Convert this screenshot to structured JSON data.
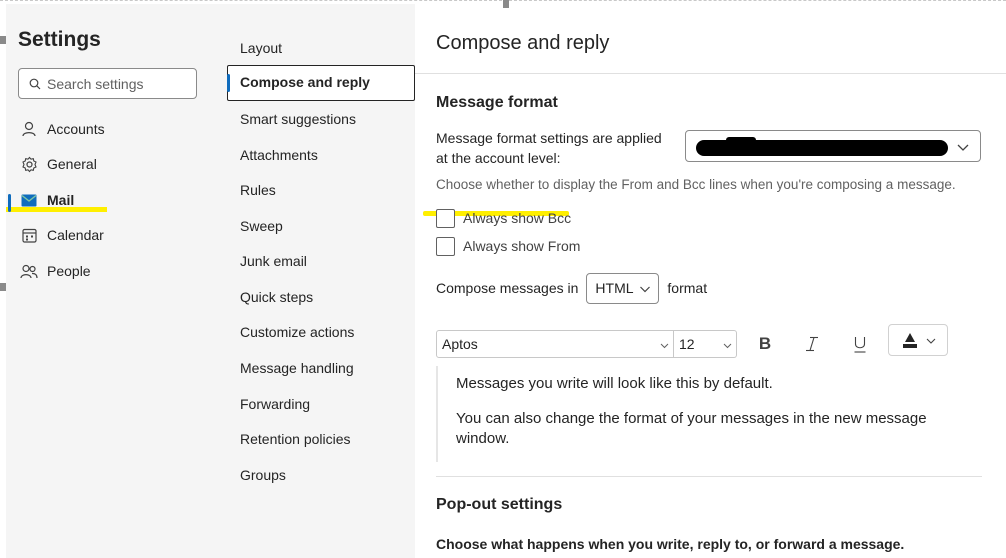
{
  "left_nav": {
    "title": "Settings",
    "search_placeholder": "Search settings",
    "items": [
      {
        "label": "Accounts",
        "icon": "person-icon"
      },
      {
        "label": "General",
        "icon": "gear-icon"
      },
      {
        "label": "Mail",
        "icon": "mail-icon",
        "active": true
      },
      {
        "label": "Calendar",
        "icon": "calendar-icon"
      },
      {
        "label": "People",
        "icon": "people-icon"
      }
    ]
  },
  "mail_nav": {
    "items": [
      "Layout",
      "Compose and reply",
      "Smart suggestions",
      "Attachments",
      "Rules",
      "Sweep",
      "Junk email",
      "Quick steps",
      "Customize actions",
      "Message handling",
      "Forwarding",
      "Retention policies",
      "Groups"
    ],
    "selected": "Compose and reply"
  },
  "main": {
    "title": "Compose and reply",
    "message_format": {
      "heading": "Message format",
      "account_label": "Message format settings are applied at the account level:",
      "account_value": "",
      "hint": "Choose whether to display the From and Bcc lines when you're composing a message.",
      "checkbox_bcc": "Always show Bcc",
      "checkbox_from": "Always show From",
      "compose_prefix": "Compose messages in",
      "compose_format": "HTML",
      "compose_suffix": "format",
      "font_name": "Aptos",
      "font_size": "12",
      "preview_line1": "Messages you write will look like this by default.",
      "preview_line2a": "You can also change the format of your messages in the new message",
      "preview_line2b": "window."
    },
    "popout": {
      "heading": "Pop-out settings",
      "description": "Choose what happens when you write, reply to, or forward a message."
    }
  },
  "colors": {
    "accent": "#0f6cbd",
    "highlight": "#ffef00",
    "pane_bg": "#f5f5f5"
  }
}
